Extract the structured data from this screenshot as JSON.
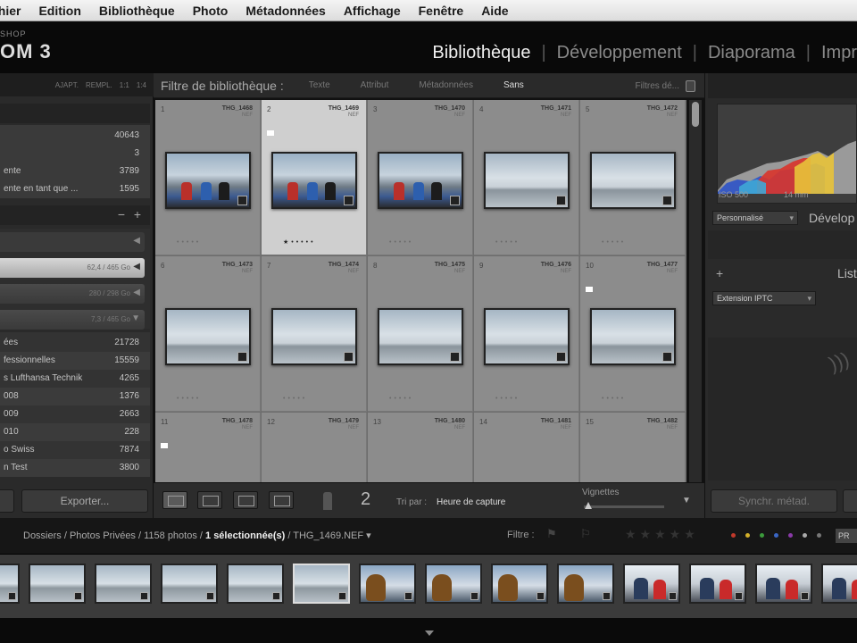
{
  "menubar": {
    "items": [
      "chier",
      "Edition",
      "Bibliothèque",
      "Photo",
      "Métadonnées",
      "Affichage",
      "Fenêtre",
      "Aide"
    ]
  },
  "identity": {
    "small": "SHOP",
    "big": "OM 3"
  },
  "modules": [
    "Bibliothèque",
    "Développement",
    "Diaporama",
    "Impr"
  ],
  "left_panel": {
    "toprow": [
      "AJAPT.",
      "REMPL.",
      "1:1",
      "1:4"
    ],
    "catalog": [
      {
        "label": "",
        "num": "40643"
      },
      {
        "label": "",
        "num": "3"
      },
      {
        "label": "ente",
        "num": "3789"
      },
      {
        "label": "ente en tant que ...",
        "num": "1595"
      }
    ],
    "volumes": [
      {
        "num": "62,4 / 465 Go"
      },
      {
        "num": "280 / 298 Go"
      },
      {
        "num": "7,3 / 465 Go"
      }
    ],
    "collections": [
      {
        "label": "ées",
        "num": "21728"
      },
      {
        "label": "fessionnelles",
        "num": "15559"
      },
      {
        "label": "s Lufthansa Technik",
        "num": "4265"
      },
      {
        "label": "008",
        "num": "1376"
      },
      {
        "label": "009",
        "num": "2663"
      },
      {
        "label": "010",
        "num": "228"
      },
      {
        "label": "o Swiss",
        "num": "7874"
      },
      {
        "label": "n Test",
        "num": "3800"
      }
    ],
    "export_label": "Exporter..."
  },
  "filterbar": {
    "title": "Filtre de bibliothèque :",
    "options": [
      "Texte",
      "Attribut",
      "Métadonnées",
      "Sans"
    ],
    "selected": "Sans",
    "right": "Filtres dé..."
  },
  "grid": {
    "cells": [
      {
        "idx": "1",
        "fname": "THG_1468",
        "sub": "NEF",
        "kind": "boat",
        "sel": false
      },
      {
        "idx": "2",
        "fname": "THG_1469",
        "sub": "NEF",
        "kind": "boat",
        "sel": true
      },
      {
        "idx": "3",
        "fname": "THG_1470",
        "sub": "NEF",
        "kind": "boat",
        "sel": false
      },
      {
        "idx": "4",
        "fname": "THG_1471",
        "sub": "NEF",
        "kind": "sky",
        "sel": false
      },
      {
        "idx": "5",
        "fname": "THG_1472",
        "sub": "NEF",
        "kind": "sky",
        "sel": false
      },
      {
        "idx": "6",
        "fname": "THG_1473",
        "sub": "NEF",
        "kind": "sky",
        "sel": false
      },
      {
        "idx": "7",
        "fname": "THG_1474",
        "sub": "NEF",
        "kind": "sky",
        "sel": false
      },
      {
        "idx": "8",
        "fname": "THG_1475",
        "sub": "NEF",
        "kind": "sky",
        "sel": false
      },
      {
        "idx": "9",
        "fname": "THG_1476",
        "sub": "NEF",
        "kind": "sky",
        "sel": false
      },
      {
        "idx": "10",
        "fname": "THG_1477",
        "sub": "NEF",
        "kind": "sky",
        "sel": false
      },
      {
        "idx": "11",
        "fname": "THG_1478",
        "sub": "NEF",
        "kind": "sky",
        "sel": false
      },
      {
        "idx": "12",
        "fname": "THG_1479",
        "sub": "NEF",
        "kind": "sky",
        "sel": false
      },
      {
        "idx": "13",
        "fname": "THG_1480",
        "sub": "NEF",
        "kind": "sky",
        "sel": false
      },
      {
        "idx": "14",
        "fname": "THG_1481",
        "sub": "NEF",
        "kind": "sky",
        "sel": false
      },
      {
        "idx": "15",
        "fname": "THG_1482",
        "sub": "NEF",
        "kind": "sky",
        "sel": false
      }
    ]
  },
  "toolbar": {
    "sort_label": "Tri par :",
    "sort_value": "Heure de capture",
    "thumbs_label": "Vignettes"
  },
  "right_panel": {
    "iso": "ISO 500",
    "focal": "14 mm",
    "preset": "Personnalisé",
    "develop_title": "Dévelop",
    "list_title": "List",
    "iptc": "Extension IPTC",
    "sync_label": "Synchr. métad."
  },
  "filmstrip_bar": {
    "path_prefix": "Dossiers / Photos Privées / 1158 photos / ",
    "path_selected": "1 sélectionnée(s)",
    "path_file": " / THG_1469.NEF ▾",
    "filter_label": "Filtre :",
    "pref_label": "PR"
  },
  "filmstrip": [
    {
      "kind": "sky"
    },
    {
      "kind": "sky"
    },
    {
      "kind": "sky"
    },
    {
      "kind": "sky"
    },
    {
      "kind": "sky"
    },
    {
      "kind": "sky",
      "sel": true
    },
    {
      "kind": "dog"
    },
    {
      "kind": "dog"
    },
    {
      "kind": "dog"
    },
    {
      "kind": "dog"
    },
    {
      "kind": "people"
    },
    {
      "kind": "people"
    },
    {
      "kind": "people"
    },
    {
      "kind": "people"
    }
  ],
  "colors": {
    "accent": "#f0f0f0",
    "panel_bg": "#2a2a2a",
    "grid_bg": "#6d6d6d",
    "selected_cell": "#cfcfcf"
  }
}
